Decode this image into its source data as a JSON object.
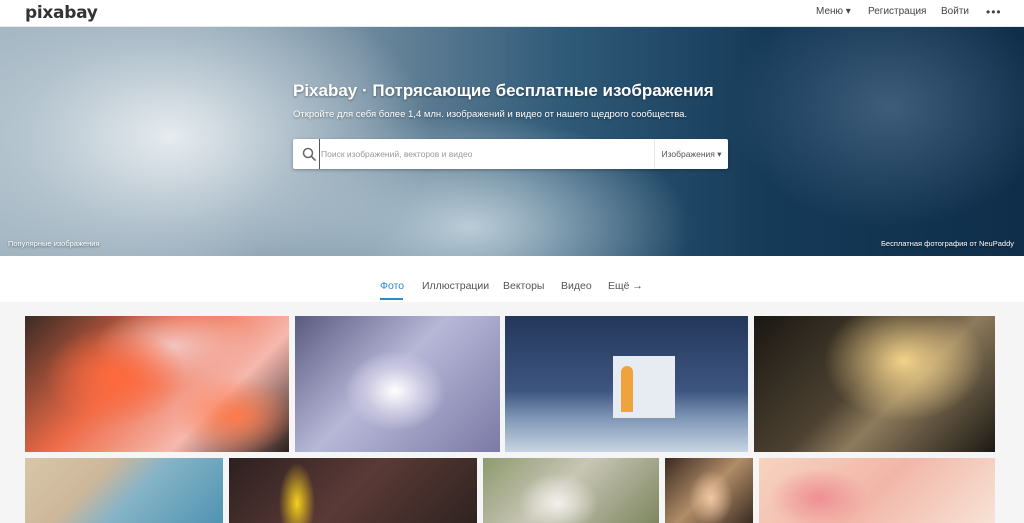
{
  "header": {
    "logo": "pixabay",
    "nav": {
      "menu": "Меню ▾",
      "register": "Регистрация",
      "login": "Войти",
      "more": "•••"
    }
  },
  "hero": {
    "title": "Pixabay · Потрясающие бесплатные изображения",
    "subtitle": "Откройте для себя более 1,4 млн. изображений и видео от нашего щедрого сообщества.",
    "search": {
      "placeholder": "Поиск изображений, векторов и видео",
      "value": "",
      "type_label": "Изображения ▾"
    },
    "caption_left": "Популярные изображения",
    "caption_right": "Бесплатная фотография от NeuPaddy"
  },
  "tabs": [
    {
      "label": "Фото",
      "active": true
    },
    {
      "label": "Иллюстрации",
      "active": false
    },
    {
      "label": "Векторы",
      "active": false
    },
    {
      "label": "Видео",
      "active": false
    },
    {
      "label": "Ещё →",
      "active": false
    }
  ],
  "accent_color": "#2b8bc6",
  "photos": [
    "flamingos",
    "frost-crystal",
    "chapel-at-night",
    "light-bulbs",
    "seashore",
    "yellow-flower",
    "sheep",
    "portrait-woman",
    "pink-flowers"
  ]
}
